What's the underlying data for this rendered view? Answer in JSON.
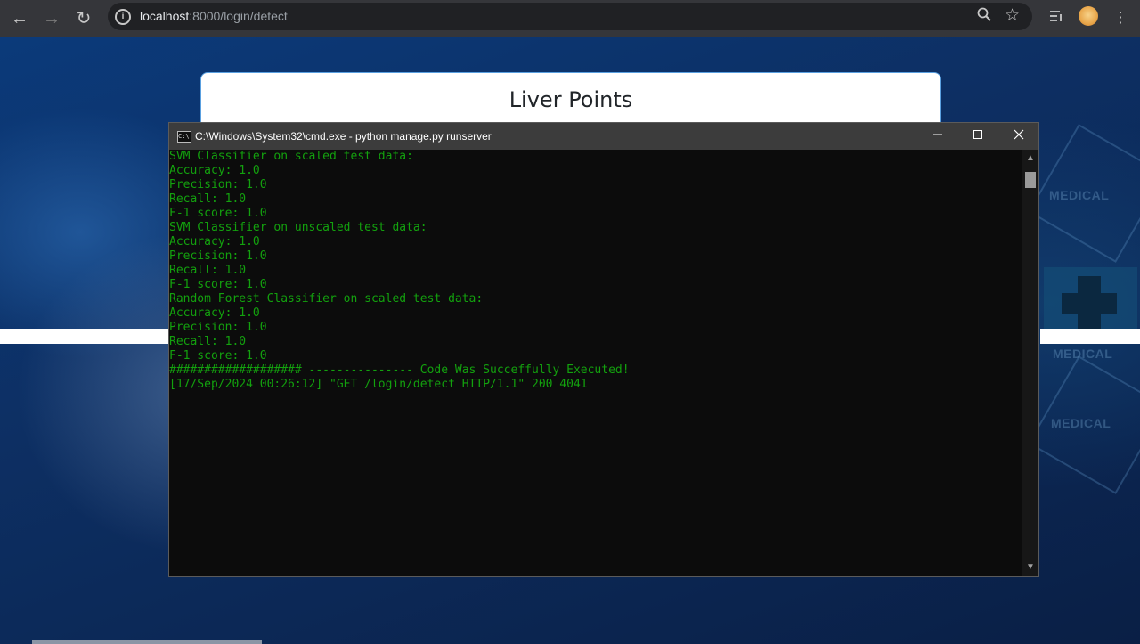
{
  "browser": {
    "url_host": "localhost",
    "url_rest": ":8000/login/detect"
  },
  "page": {
    "card_title": "Liver Points",
    "bg_labels": [
      "MEDICAL",
      "MEDICAL",
      "MEDICAL"
    ]
  },
  "console": {
    "title": "C:\\Windows\\System32\\cmd.exe - python  manage.py runserver",
    "icon_text": "C:\\",
    "lines": [
      "SVM Classifier on scaled test data:",
      "Accuracy: 1.0",
      "Precision: 1.0",
      "Recall: 1.0",
      "F-1 score: 1.0",
      "SVM Classifier on unscaled test data:",
      "Accuracy: 1.0",
      "Precision: 1.0",
      "Recall: 1.0",
      "F-1 score: 1.0",
      "Random Forest Classifier on scaled test data:",
      "Accuracy: 1.0",
      "Precision: 1.0",
      "Recall: 1.0",
      "F-1 score: 1.0",
      "################### --------------- Code Was Succeffully Executed!",
      "[17/Sep/2024 00:26:12] \"GET /login/detect HTTP/1.1\" 200 4041"
    ]
  },
  "colors": {
    "console_text": "#13a10e",
    "console_bg": "#0c0c0c",
    "chrome_bg": "#35363a"
  },
  "icons": [
    "back-arrow-icon",
    "forward-arrow-icon",
    "reload-icon",
    "site-info-icon",
    "zoom-icon",
    "bookmark-star-icon",
    "reading-list-icon",
    "profile-avatar",
    "menu-kebab-icon",
    "cmd-app-icon",
    "minimize-icon",
    "maximize-icon",
    "close-icon",
    "scroll-up-icon",
    "scroll-down-icon"
  ]
}
